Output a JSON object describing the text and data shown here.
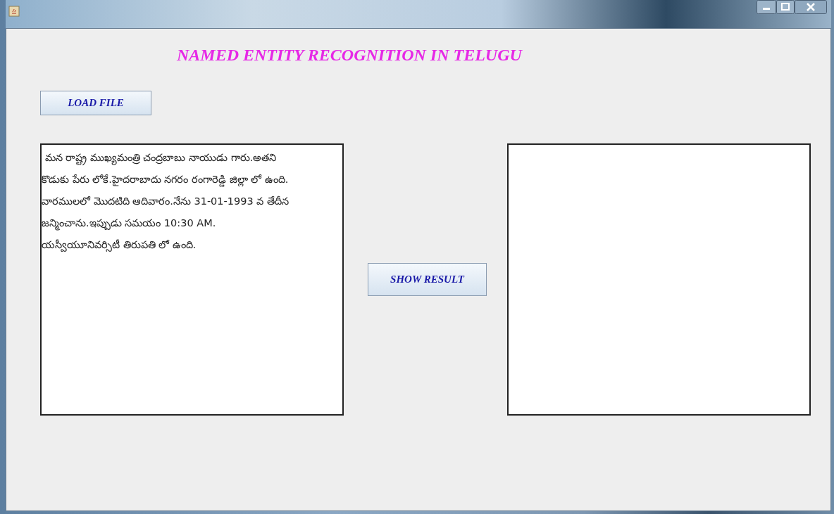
{
  "heading": "NAMED ENTITY RECOGNITION IN TELUGU",
  "load_button": "LOAD FILE",
  "input_text": {
    "lines": [
      " మన రాష్ట్ర ముఖ్యమంత్రి చంద్రబాబు నాయుడు గారు.అతని",
      "కొడుకు పేరు లోకే.హైదరాబాదు నగరం రంగారెడ్డి జిల్లా లో ఉంది.",
      "వారములలో మొదటిది ఆదివారం.నేను 31-01-1993 వ తేదీన",
      "జన్మించాను.ఇప్పుడు సమయం 10:30 AM.",
      "యస్వీయూనివర్సిటీ తిరుపతి లో ఉంది."
    ]
  },
  "result_button": "SHOW RESULT"
}
